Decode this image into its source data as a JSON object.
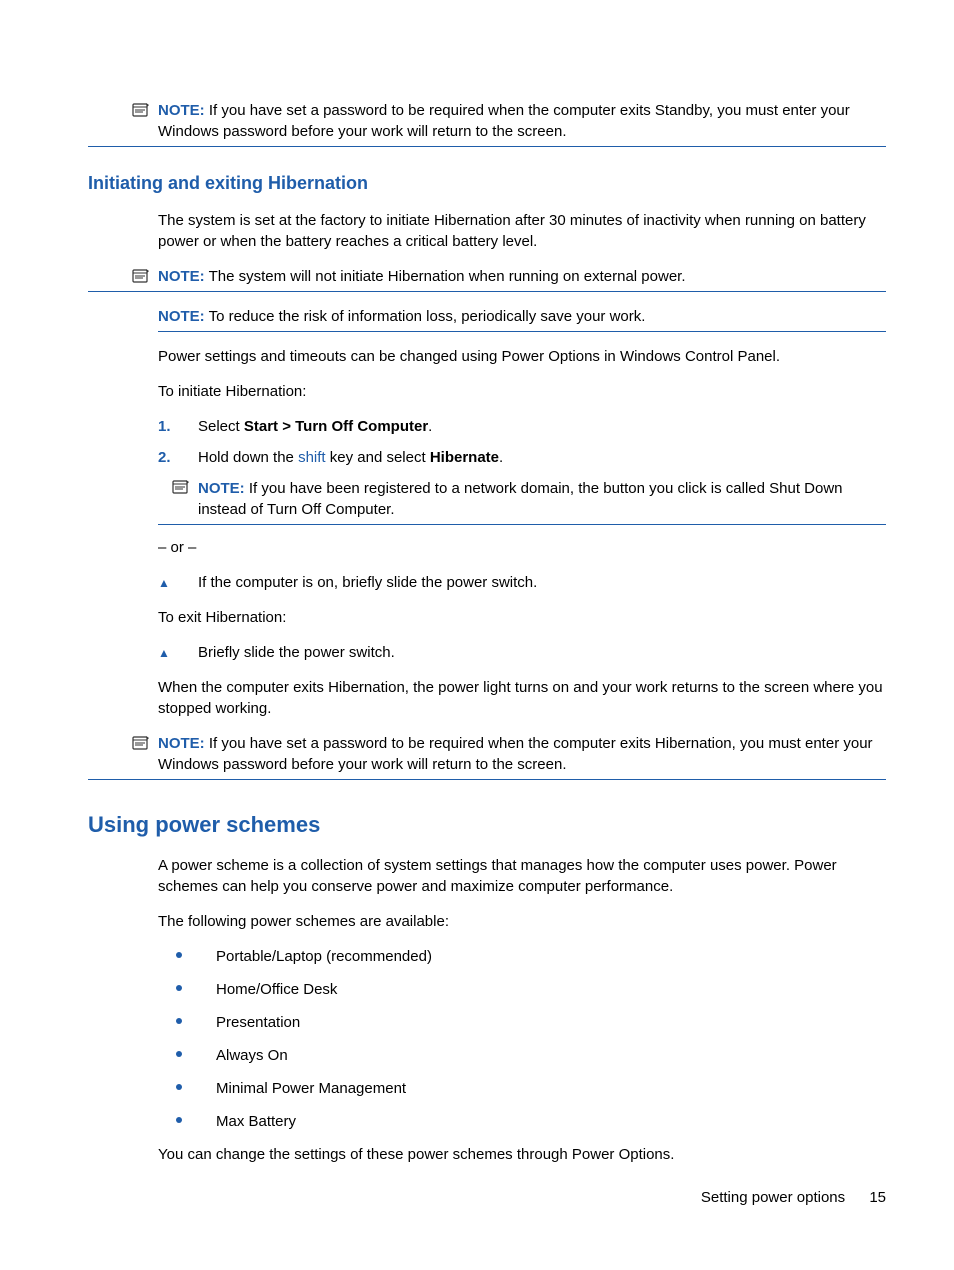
{
  "note_label": "NOTE:",
  "note1_text": "If you have set a password to be required when the computer exits Standby, you must enter your Windows password before your work will return to the screen.",
  "h3_hibernate": "Initiating and exiting Hibernation",
  "hib_intro": "The system is set at the factory to initiate Hibernation after 30 minutes of inactivity when running on battery power or when the battery reaches a critical battery level.",
  "note2_text": "The system will not initiate Hibernation when running on external power.",
  "note3_text": "To reduce the risk of information loss, periodically save your work.",
  "para_power_settings": "Power settings and timeouts can be changed using Power Options in Windows Control Panel.",
  "para_initiate": "To initiate Hibernation:",
  "step1_num": "1.",
  "step1_pre": "Select ",
  "step1_bold": "Start > Turn Off Computer",
  "step1_post": ".",
  "step2_num": "2.",
  "step2_pre": "Hold down the ",
  "step2_key": "shift",
  "step2_mid": " key and select ",
  "step2_bold": "Hibernate",
  "step2_post": ".",
  "note4_text": "If you have been registered to a network domain, the button you click is called Shut Down instead of Turn Off Computer.",
  "or_text": "– or –",
  "tri1_text": "If the computer is on, briefly slide the power switch.",
  "para_exit": "To exit Hibernation:",
  "tri2_text": "Briefly slide the power switch.",
  "para_when_exits": "When the computer exits Hibernation, the power light turns on and your work returns to the screen where you stopped working.",
  "note5_text": "If you have set a password to be required when the computer exits Hibernation, you must enter your Windows password before your work will return to the screen.",
  "h2_power_schemes": "Using power schemes",
  "ps_intro": "A power scheme is a collection of system settings that manages how the computer uses power. Power schemes can help you conserve power and maximize computer performance.",
  "ps_following": "The following power schemes are available:",
  "schemes": {
    "s0": "Portable/Laptop (recommended)",
    "s1": "Home/Office Desk",
    "s2": "Presentation",
    "s3": "Always On",
    "s4": "Minimal Power Management",
    "s5": "Max Battery"
  },
  "ps_change": "You can change the settings of these power schemes through Power Options.",
  "footer_text": "Setting power options",
  "footer_page": "15"
}
